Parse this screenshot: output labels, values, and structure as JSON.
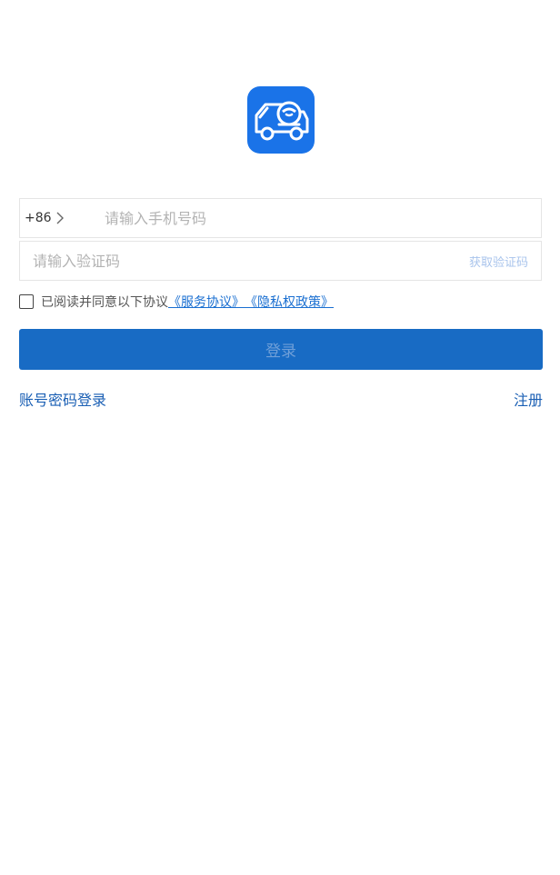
{
  "logo": {
    "icon": "delivery-van-robot-icon",
    "color": "#1a73e8"
  },
  "phone": {
    "country_code": "+86",
    "placeholder": "请输入手机号码",
    "value": ""
  },
  "code": {
    "placeholder": "请输入验证码",
    "value": "",
    "get_code_label": "获取验证码"
  },
  "agreement": {
    "checked": false,
    "prefix": "已阅读并同意以下协议",
    "service_link": "《服务协议》",
    "privacy_link": "《隐私权政策》"
  },
  "login_button": {
    "label": "登录",
    "color": "#186bc4"
  },
  "links": {
    "password_login": "账号密码登录",
    "register": "注册"
  }
}
